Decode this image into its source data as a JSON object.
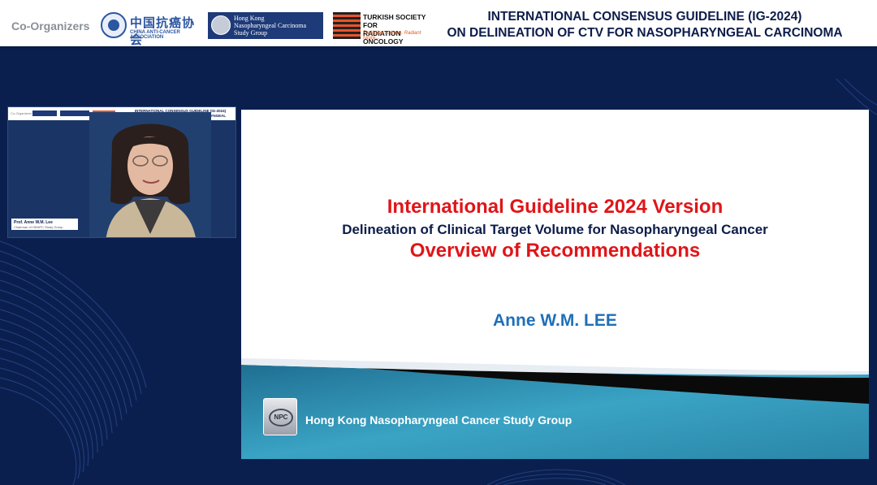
{
  "banner": {
    "co_label": "Co-Organizers",
    "logo_china_cn": "中国抗癌协会",
    "logo_china_en": "CHINA ANTI-CANCER ASSOCIATION",
    "logo_hk_line1": "Hong Kong",
    "logo_hk_line2": "Nasopharyngeal Carcinoma",
    "logo_hk_line3": "Study Group",
    "logo_tr_line1": "TURKISH SOCIETY FOR",
    "logo_tr_line2": "RADIATION ONCOLOGY",
    "logo_tr_tagline": "Radiating science, Radiant future...",
    "title_line1": "INTERNATIONAL CONSENSUS GUIDELINE (IG-2024)",
    "title_line2": "ON DELINEATION OF CTV FOR NASOPHARYNGEAL CARCINOMA"
  },
  "camera": {
    "mini_co_label": "Co-Organizers",
    "mini_title_line1": "INTERNATIONAL CONSENSUS GUIDELINE (IG-2024)",
    "mini_title_line2": "ON DELINEATION OF CTV FOR NASOPHARYNGEAL CARCINOMA",
    "speaker_name": "Prof. Anne W.M. Lee",
    "speaker_role": "Chairman of HKNPC Study Group"
  },
  "slide": {
    "title": "International Guideline 2024 Version",
    "subtitle": "Delineation of Clinical Target Volume for Nasopharyngeal Cancer",
    "subtitle2": "Overview of Recommendations",
    "author": "Anne W.M. LEE",
    "org_logo_text": "NPC",
    "org_name": "Hong Kong Nasopharyngeal Cancer Study Group"
  },
  "colors": {
    "background": "#0b1f4f",
    "title_red": "#e01518",
    "navy": "#0d1d4a",
    "author_blue": "#1f6fb8",
    "teal": "#2b8fae"
  }
}
